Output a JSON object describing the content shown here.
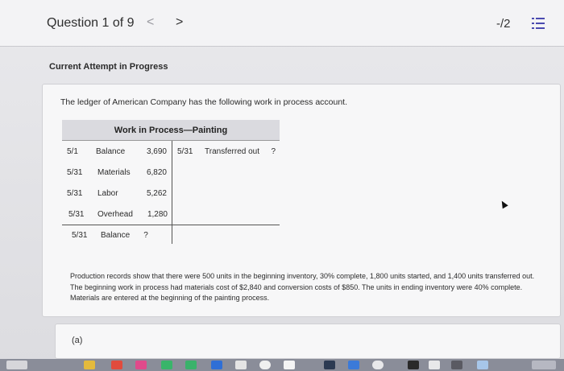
{
  "header": {
    "question_label": "Question 1 of 9",
    "prev_glyph": "<",
    "next_glyph": ">",
    "score": "-/2",
    "list_icon": "list-icon"
  },
  "attempt_status": "Current Attempt in Progress",
  "problem": {
    "intro": "The ledger of American Company has the following work in process account.",
    "ledger": {
      "title": "Work in Process—Painting",
      "debits": [
        {
          "date": "5/1",
          "label": "Balance",
          "value": "3,690"
        },
        {
          "date": "5/31",
          "label": "Materials",
          "value": "6,820"
        },
        {
          "date": "5/31",
          "label": "Labor",
          "value": "5,262"
        },
        {
          "date": "5/31",
          "label": "Overhead",
          "value": "1,280"
        }
      ],
      "credits": [
        {
          "date": "5/31",
          "label": "Transferred out",
          "value": "?"
        }
      ],
      "ending": {
        "date": "5/31",
        "label": "Balance",
        "value": "?"
      }
    },
    "paragraph": "Production records show that there were 500 units in the beginning inventory, 30% complete, 1,800 units started, and 1,400 units transferred out. The beginning work in process had materials cost of $2,840 and conversion costs of $850. The units in ending inventory were 40% complete. Materials are entered at the beginning of the painting process."
  },
  "part": {
    "label": "(a)"
  },
  "colors": {
    "list_icon": "#4a4ab0",
    "taskbar": "#8a8d99"
  }
}
